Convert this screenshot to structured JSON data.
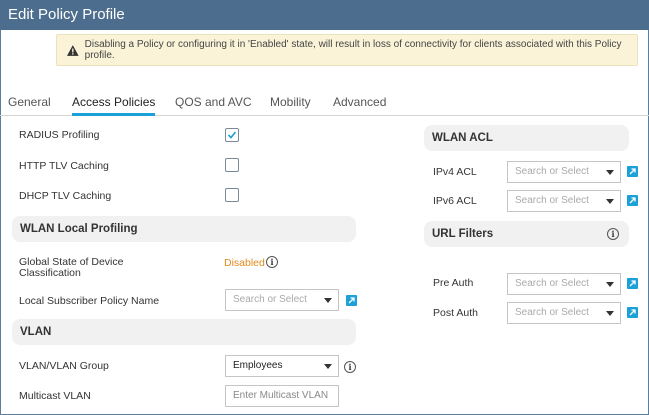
{
  "window": {
    "title": "Edit Policy Profile"
  },
  "warning": {
    "text": "Disabling a Policy or configuring it in 'Enabled' state, will result in loss of connectivity for clients associated with this Policy profile."
  },
  "tabs": [
    {
      "label": "General",
      "active": false
    },
    {
      "label": "Access Policies",
      "active": true
    },
    {
      "label": "QOS and AVC",
      "active": false
    },
    {
      "label": "Mobility",
      "active": false
    },
    {
      "label": "Advanced",
      "active": false
    }
  ],
  "left": {
    "radius_profiling": {
      "label": "RADIUS Profiling",
      "checked": true
    },
    "http_tlv": {
      "label": "HTTP TLV Caching",
      "checked": false
    },
    "dhcp_tlv": {
      "label": "DHCP TLV Caching",
      "checked": false
    },
    "wlan_local_profiling": {
      "title": "WLAN Local Profiling"
    },
    "global_state": {
      "label_line1": "Global State of Device",
      "label_line2": "Classification",
      "value": "Disabled"
    },
    "local_subscriber": {
      "label": "Local Subscriber Policy Name",
      "placeholder": "Search or Select"
    },
    "vlan_section": {
      "title": "VLAN"
    },
    "vlan_group": {
      "label": "VLAN/VLAN Group",
      "value": "Employees"
    },
    "multicast_vlan": {
      "label": "Multicast VLAN",
      "placeholder": "Enter Multicast VLAN"
    }
  },
  "right": {
    "wlan_acl": {
      "title": "WLAN ACL"
    },
    "ipv4_acl": {
      "label": "IPv4 ACL",
      "placeholder": "Search or Select"
    },
    "ipv6_acl": {
      "label": "IPv6 ACL",
      "placeholder": "Search or Select"
    },
    "url_filters": {
      "title": "URL Filters"
    },
    "pre_auth": {
      "label": "Pre Auth",
      "placeholder": "Search or Select"
    },
    "post_auth": {
      "label": "Post Auth",
      "placeholder": "Search or Select"
    }
  },
  "colors": {
    "titlebar": "#4d6d8e",
    "accent": "#1ba0d7",
    "warning_bg": "#faf3d8",
    "disabled_text": "#e08a1e"
  }
}
